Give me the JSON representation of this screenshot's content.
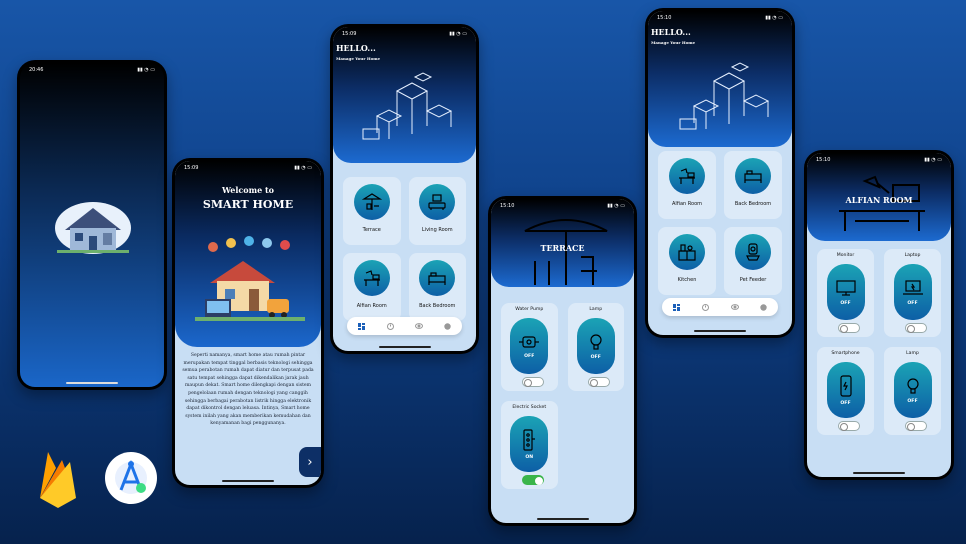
{
  "colors": {
    "accent": "#1b67cc",
    "card": "#dceaf8",
    "toggle_on": "#3bb54a"
  },
  "splash": {
    "status_time": "20:46"
  },
  "welcome": {
    "status_time": "15:09",
    "title_line1": "Welcome to",
    "title_line2": "SMART HOME",
    "description": "Seperti namanya, smart home atau rumah pintar merupakan tempat tinggal berbasis teknologi sehingga semua perabotan rumah dapat diatur dan terpusat pada satu tempat sehingga dapat dikendalikan jarak jauh maupun dekat. Smart home dilengkapi dengan sistem pengelolaan rumah dengan teknologi yang canggih sehingga berbagai perabotan listrik hingga elektronik dapat dikontrol dengan leluasa. Intinya, Smart home system inilah yang akan memberikan kemudahan dan kenyamanan bagi penggunanya.",
    "next_icon": "chevron-right-icon"
  },
  "home1": {
    "status_time": "15:09",
    "greeting": "HELLO...",
    "subtitle": "Manage Your Home",
    "rooms": [
      "Terrace",
      "Living Room",
      "Alfian Room",
      "Back Bedroom"
    ]
  },
  "terrace": {
    "status_time": "15:10",
    "title": "TERRACE",
    "devices": [
      {
        "name": "Water Pump",
        "state": "OFF",
        "on": false
      },
      {
        "name": "Lamp",
        "state": "OFF",
        "on": false
      },
      {
        "name": "Electric Socket",
        "state": "ON",
        "on": true
      }
    ]
  },
  "home2": {
    "status_time": "15:10",
    "greeting": "HELLO...",
    "subtitle": "Manage Your Home",
    "rooms": [
      "Alfian Room",
      "Back Bedroom",
      "Kitchen",
      "Pet Feeder"
    ]
  },
  "alfian": {
    "status_time": "15:10",
    "title": "ALFIAN ROOM",
    "devices": [
      {
        "name": "Monitor",
        "state": "OFF",
        "on": false
      },
      {
        "name": "Laptop",
        "state": "OFF",
        "on": false
      },
      {
        "name": "Smartphone",
        "state": "OFF",
        "on": false
      },
      {
        "name": "Lamp",
        "state": "OFF",
        "on": false
      }
    ]
  },
  "nav_icons": [
    "grid-icon",
    "timer-icon",
    "eye-icon",
    "info-icon"
  ],
  "logos": [
    "firebase-logo",
    "android-studio-logo"
  ]
}
